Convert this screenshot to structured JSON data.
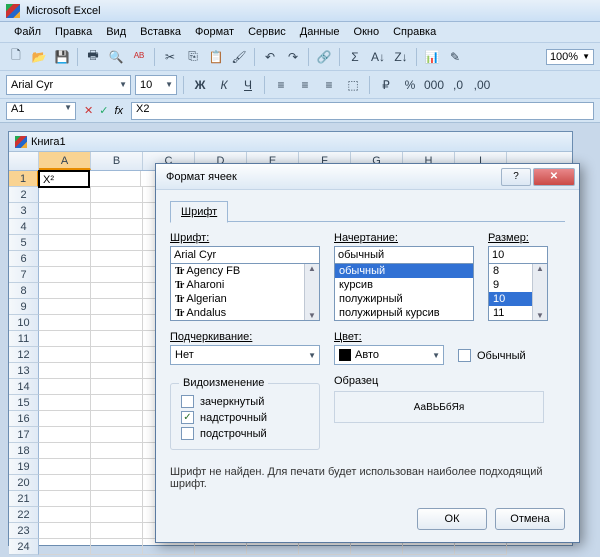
{
  "app": {
    "title": "Microsoft Excel"
  },
  "menu": [
    "Файл",
    "Правка",
    "Вид",
    "Вставка",
    "Формат",
    "Сервис",
    "Данные",
    "Окно",
    "Справка"
  ],
  "font": {
    "name": "Arial Cyr",
    "size": "10"
  },
  "formula": {
    "cellref": "A1",
    "value": "X2"
  },
  "workbook": {
    "title": "Книга1"
  },
  "columns": [
    "A",
    "B",
    "C",
    "D",
    "E",
    "F",
    "G",
    "H",
    "I"
  ],
  "cell_value": "X²",
  "zoom": "100%",
  "dialog": {
    "title": "Формат ячеек",
    "tab": "Шрифт",
    "font_label": "Шрифт:",
    "font_value": "Arial Cyr",
    "font_list": [
      "Agency FB",
      "Aharoni",
      "Algerian",
      "Andalus"
    ],
    "style_label": "Начертание:",
    "style_value": "обычный",
    "style_list": [
      "обычный",
      "курсив",
      "полужирный",
      "полужирный курсив"
    ],
    "size_label": "Размер:",
    "size_value": "10",
    "size_list": [
      "8",
      "9",
      "10",
      "11"
    ],
    "underline_label": "Подчеркивание:",
    "underline_value": "Нет",
    "color_label": "Цвет:",
    "color_value": "Авто",
    "normal_check": "Обычный",
    "mod_group": "Видоизменение",
    "mod_strike": "зачеркнутый",
    "mod_super": "надстрочный",
    "mod_sub": "подстрочный",
    "sample_label": "Образец",
    "sample_text": "АаВЬБбЯя",
    "note": "Шрифт не найден. Для печати будет использован наиболее подходящий шрифт.",
    "ok": "ОК",
    "cancel": "Отмена",
    "help": "?",
    "close": "✕"
  }
}
